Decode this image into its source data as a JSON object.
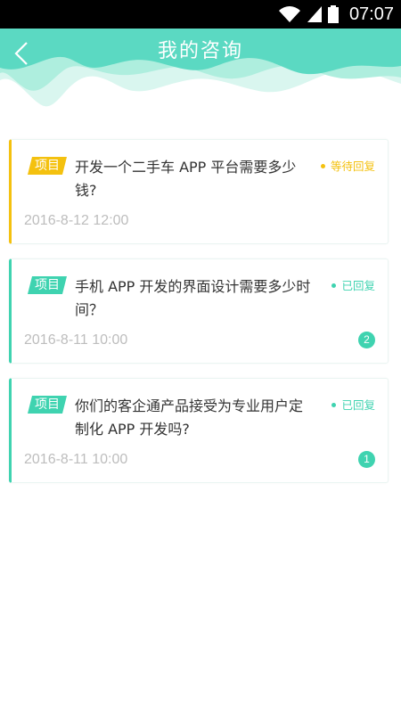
{
  "status_bar": {
    "time": "07:07",
    "icons": [
      "wifi-icon",
      "signal-icon",
      "battery-icon"
    ]
  },
  "header": {
    "title": "我的咨询",
    "back_icon": "chevron-left-icon",
    "colors": {
      "primary": "#5bd9c2",
      "wave_light": "#aeeede",
      "wave_pale": "#d9f6ef"
    }
  },
  "consultations": [
    {
      "tag": "项目",
      "question": "开发一个二手车 APP 平台需要多少钱?",
      "status": "等待回复",
      "date": "2016-8-12 12:00",
      "state": "pending"
    },
    {
      "tag": "项目",
      "question": "手机 APP 开发的界面设计需要多少时间？",
      "status": "已回复",
      "date": "2016-8-11 10:00",
      "count": "2",
      "state": "replied"
    },
    {
      "tag": "项目",
      "question": "你们的客企通产品接受为专业用户定制化 APP 开发吗?",
      "status": "已回复",
      "date": "2016-8-11 10:00",
      "count": "1",
      "state": "replied"
    }
  ],
  "colors": {
    "pending": "#f4c10f",
    "replied": "#3fd3b0"
  }
}
